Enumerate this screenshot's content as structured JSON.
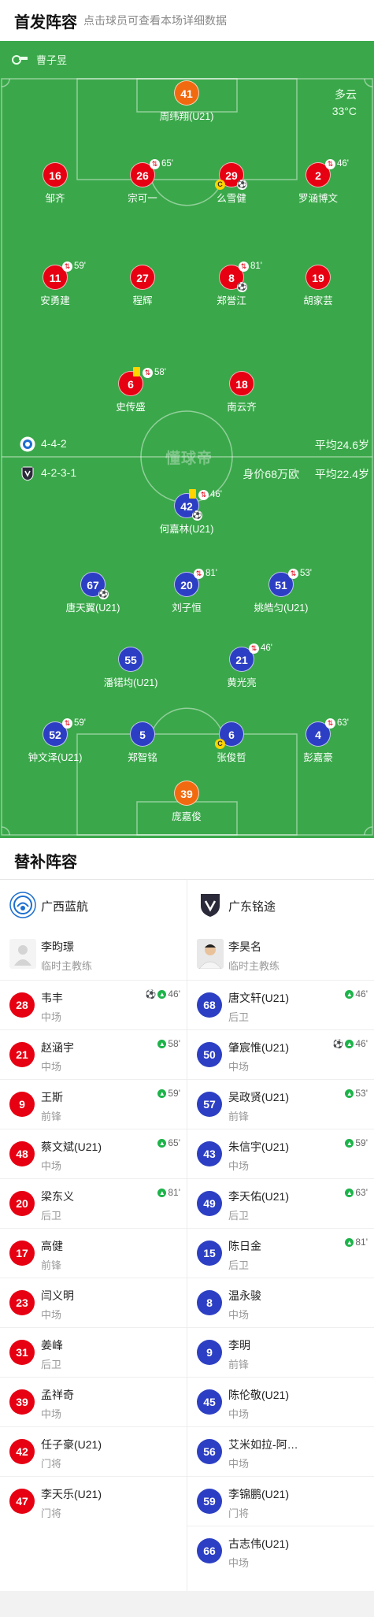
{
  "header": {
    "title": "首发阵容",
    "subtitle": "点击球员可查看本场详细数据"
  },
  "match_info": {
    "referee": "曹子昱",
    "weather": "多云",
    "temperature": "33°C",
    "watermark": "懂球帝"
  },
  "colors": {
    "pitch": "#3aa84a",
    "home_kit": "#e60012",
    "away_kit": "#2c3fc4",
    "goalkeeper": "#f26a10"
  },
  "home_team": {
    "name": "广西蓝航",
    "formation": "4-4-2",
    "avg_age": "平均24.6岁"
  },
  "away_team": {
    "name": "广东铭途",
    "formation": "4-2-3-1",
    "market_value": "身价68万欧",
    "avg_age": "平均22.4岁"
  },
  "home_starters": [
    {
      "num": "41",
      "name": "周纬翔(U21)",
      "gk": true
    },
    {
      "num": "16",
      "name": "邹齐"
    },
    {
      "num": "26",
      "name": "宗可一",
      "sub": "65'"
    },
    {
      "num": "29",
      "name": "么雪健",
      "captain": "C",
      "ball": "⚽"
    },
    {
      "num": "2",
      "name": "罗涵博文",
      "sub": "46'"
    },
    {
      "num": "11",
      "name": "安勇建",
      "sub": "59'"
    },
    {
      "num": "27",
      "name": "程辉"
    },
    {
      "num": "8",
      "name": "郑誉江",
      "sub": "81'",
      "ball": "⚽"
    },
    {
      "num": "19",
      "name": "胡家芸"
    },
    {
      "num": "6",
      "name": "史传盛",
      "sub": "58'",
      "yellow": true
    },
    {
      "num": "18",
      "name": "南云齐"
    }
  ],
  "away_starters": [
    {
      "num": "42",
      "name": "何嘉林(U21)",
      "sub": "46'",
      "yellow": true,
      "ball": "⚽"
    },
    {
      "num": "67",
      "name": "唐天翼(U21)",
      "ball": "⚽"
    },
    {
      "num": "20",
      "name": "刘子恒",
      "sub": "81'"
    },
    {
      "num": "51",
      "name": "姚皓匀(U21)",
      "sub": "53'"
    },
    {
      "num": "55",
      "name": "潘锘均(U21)"
    },
    {
      "num": "21",
      "name": "黄光亮",
      "sub": "46'"
    },
    {
      "num": "52",
      "name": "钟文泽(U21)",
      "sub": "59'"
    },
    {
      "num": "5",
      "name": "郑智铭"
    },
    {
      "num": "6",
      "name": "张俊哲",
      "captain": "C"
    },
    {
      "num": "4",
      "name": "彭嘉豪",
      "sub": "63'"
    },
    {
      "num": "39",
      "name": "庞嘉俊",
      "gk": true
    }
  ],
  "bench": {
    "title": "替补阵容",
    "home": {
      "team": "广西蓝航",
      "coach": {
        "name": "李昀璟",
        "role": "临时主教练"
      },
      "players": [
        {
          "num": "28",
          "name": "韦丰",
          "pos": "中场",
          "sub": "46'",
          "goal": "⚽"
        },
        {
          "num": "21",
          "name": "赵涵宇",
          "pos": "中场",
          "sub": "58'"
        },
        {
          "num": "9",
          "name": "王斯",
          "pos": "前锋",
          "sub": "59'"
        },
        {
          "num": "48",
          "name": "蔡文斌(U21)",
          "pos": "中场",
          "sub": "65'"
        },
        {
          "num": "20",
          "name": "梁东义",
          "pos": "后卫",
          "sub": "81'"
        },
        {
          "num": "17",
          "name": "高健",
          "pos": "前锋"
        },
        {
          "num": "23",
          "name": "闫义明",
          "pos": "中场"
        },
        {
          "num": "31",
          "name": "姜峰",
          "pos": "后卫"
        },
        {
          "num": "39",
          "name": "孟祥奇",
          "pos": "中场"
        },
        {
          "num": "42",
          "name": "任子豪(U21)",
          "pos": "门将"
        },
        {
          "num": "47",
          "name": "李天乐(U21)",
          "pos": "门将"
        }
      ]
    },
    "away": {
      "team": "广东铭途",
      "coach": {
        "name": "李昊名",
        "role": "临时主教练"
      },
      "players": [
        {
          "num": "68",
          "name": "唐文轩(U21)",
          "pos": "后卫",
          "sub": "46'"
        },
        {
          "num": "50",
          "name": "肇宸惟(U21)",
          "pos": "中场",
          "sub": "46'",
          "goal": "⚽"
        },
        {
          "num": "57",
          "name": "吴政贤(U21)",
          "pos": "前锋",
          "sub": "53'"
        },
        {
          "num": "43",
          "name": "朱信宇(U21)",
          "pos": "中场",
          "sub": "59'"
        },
        {
          "num": "49",
          "name": "李天佑(U21)",
          "pos": "后卫",
          "sub": "63'"
        },
        {
          "num": "15",
          "name": "陈日金",
          "pos": "后卫",
          "sub": "81'"
        },
        {
          "num": "8",
          "name": "温永骏",
          "pos": "中场"
        },
        {
          "num": "9",
          "name": "李明",
          "pos": "前锋"
        },
        {
          "num": "45",
          "name": "陈伦敬(U21)",
          "pos": "中场"
        },
        {
          "num": "56",
          "name": "艾米如拉-阿…",
          "pos": "中场"
        },
        {
          "num": "59",
          "name": "李锦鹏(U21)",
          "pos": "门将"
        },
        {
          "num": "66",
          "name": "古志伟(U21)",
          "pos": "中场"
        }
      ]
    }
  }
}
